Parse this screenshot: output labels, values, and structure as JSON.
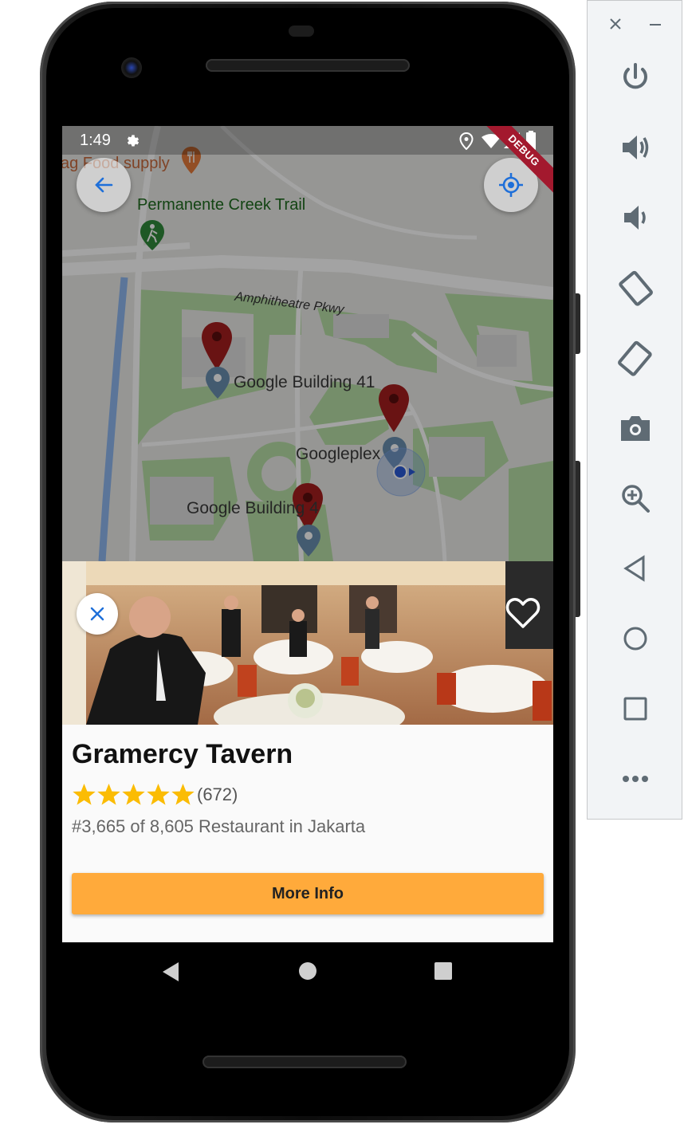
{
  "status_bar": {
    "time": "1:49",
    "debug_label": "DEBUG"
  },
  "map": {
    "labels": {
      "food_supply": "ag Food supply",
      "trail": "Permanente Creek Trail",
      "road": "Amphitheatre Pkwy",
      "building_41": "Google Building 41",
      "googleplex": "Googleplex",
      "building_4x": "Google Building 4"
    }
  },
  "restaurant": {
    "name": "Gramercy Tavern",
    "rating": 5,
    "review_count": "(672)",
    "rank": "#3,665 of 8,605 Restaurant in Jakarta",
    "more_info_label": "More Info"
  },
  "colors": {
    "accent_orange": "#ffaa3b",
    "star_yellow": "#fbbc04",
    "marker_red": "#9e1c1c",
    "debug_red": "#a3192e",
    "fab_blue": "#1e6fd9"
  },
  "icons": {
    "back": "arrow-left-icon",
    "my_location": "crosshair-icon",
    "close": "close-icon",
    "favorite": "heart-outline-icon",
    "settings": "gear-icon",
    "location": "location-pin-icon",
    "wifi": "wifi-icon",
    "signal": "signal-icon",
    "battery": "battery-icon"
  },
  "emulator": {
    "controls": [
      "power",
      "volume-up",
      "volume-down",
      "rotate-left",
      "rotate-right",
      "screenshot",
      "zoom",
      "back",
      "home",
      "overview",
      "more"
    ]
  }
}
